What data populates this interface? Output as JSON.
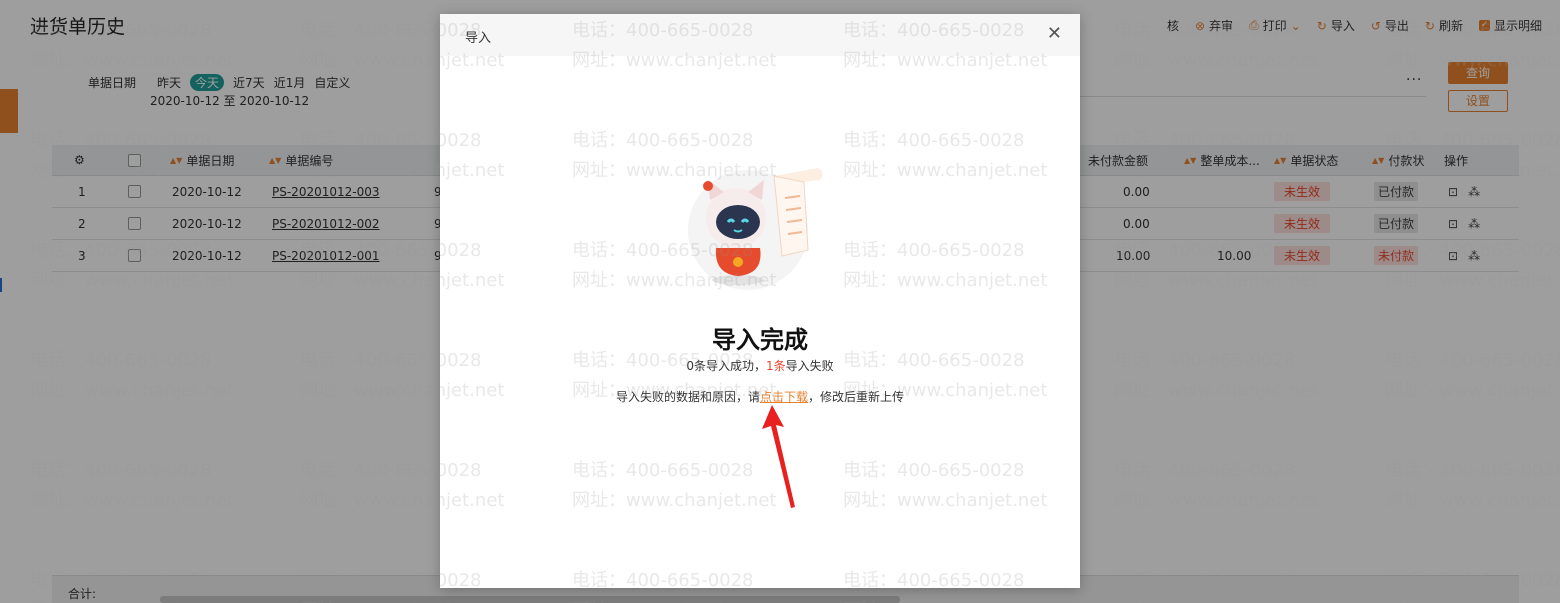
{
  "page": {
    "title": "进货单历史"
  },
  "toolbar": {
    "items": [
      {
        "label": "核"
      },
      {
        "icon": "discard-icon",
        "label": "弃审"
      },
      {
        "icon": "print-icon",
        "label": "打印"
      },
      {
        "icon": "import-icon",
        "label": "导入"
      },
      {
        "icon": "export-icon",
        "label": "导出"
      },
      {
        "icon": "refresh-icon",
        "label": "刷新"
      }
    ],
    "show_detail": {
      "label": "显示明细",
      "checked": true
    }
  },
  "filter": {
    "label": "单据日期",
    "options": [
      "昨天",
      "今天",
      "近7天",
      "近1月",
      "自定义"
    ],
    "selected": "今天",
    "range": "2020-10-12 至 2020-10-12",
    "more": "..."
  },
  "buttons": {
    "query": "查询",
    "settings": "设置"
  },
  "table": {
    "headers": {
      "date": "单据日期",
      "number": "单据编号",
      "unpaid": "未付款金额",
      "total_cost": "整单成本...",
      "status": "单据状态",
      "payment": "付款状",
      "actions": "操作"
    },
    "rows": [
      {
        "idx": "1",
        "date": "2020-10-12",
        "number": "PS-20201012-003",
        "partial": "9",
        "unpaid": "0.00",
        "total_cost": "",
        "status": "未生效",
        "payment": "已付款"
      },
      {
        "idx": "2",
        "date": "2020-10-12",
        "number": "PS-20201012-002",
        "partial": "9",
        "unpaid": "0.00",
        "total_cost": "",
        "status": "未生效",
        "payment": "已付款"
      },
      {
        "idx": "3",
        "date": "2020-10-12",
        "number": "PS-20201012-001",
        "partial": "9",
        "unpaid": "10.00",
        "total_cost": "10.00",
        "status": "未生效",
        "payment": "未付款"
      }
    ]
  },
  "footer": {
    "total_label": "合计:"
  },
  "watermark": {
    "phone": "电话：400-665-0028",
    "site": "网址：www.chanjet.net"
  },
  "modal": {
    "title": "导入",
    "heading": "导入完成",
    "result_success": "0条导入成功，",
    "result_fail_count": "1条",
    "result_fail_text": "导入失败",
    "hint_prefix": "导入失败的数据和原因，请",
    "hint_link": "点击下载",
    "hint_suffix": "，修改后重新上传"
  },
  "colors": {
    "accent": "#e8812f",
    "teal": "#1f9e9a",
    "danger": "#e8462f"
  }
}
